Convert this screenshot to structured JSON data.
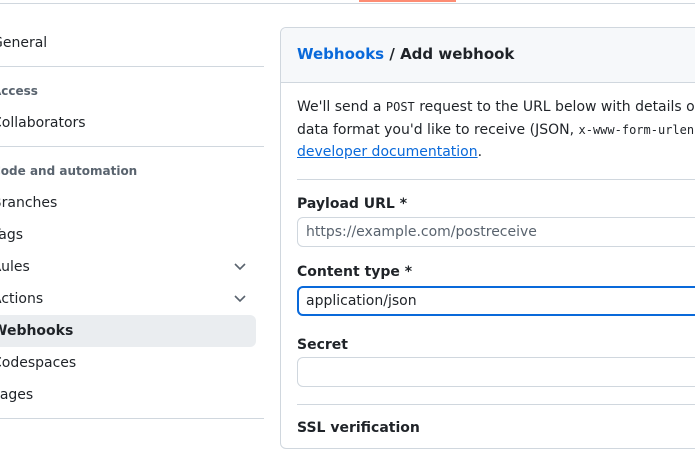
{
  "sidebar": {
    "items": [
      {
        "label": "General"
      },
      {
        "label": "Collaborators"
      },
      {
        "label": "Branches"
      },
      {
        "label": "Tags"
      },
      {
        "label": "Rules"
      },
      {
        "label": "Actions"
      },
      {
        "label": "Webhooks",
        "active": true
      },
      {
        "label": "Codespaces"
      },
      {
        "label": "Pages"
      }
    ],
    "sections": [
      "Access",
      "Code and automation"
    ]
  },
  "header": {
    "breadcrumb_parent": "Webhooks",
    "breadcrumb_sep": " / ",
    "breadcrumb_current": "Add webhook"
  },
  "description": {
    "line1_a": "We'll send a ",
    "line1_code": "POST",
    "line1_b": " request to the URL below with details of any subscribed events. You can also specify which",
    "line2_a": "data format you'd like to receive (JSON, ",
    "line2_code": "x-www-form-urlencoded",
    "line2_b": ", ",
    "link": "developer documentation",
    "line3_end": "."
  },
  "form": {
    "payload_label": "Payload URL *",
    "payload_placeholder": "https://example.com/postreceive",
    "content_type_label": "Content type *",
    "content_type_value": "application/json",
    "secret_label": "Secret",
    "ssl_label": "SSL verification"
  },
  "colors": {
    "accent": "#0969da",
    "tab_underline": "#fd8c73",
    "active_bg": "#eaedf0"
  }
}
